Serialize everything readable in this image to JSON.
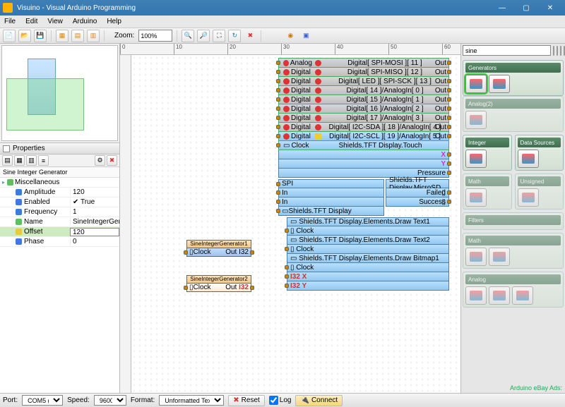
{
  "title": "Visuino - Visual Arduino Programming",
  "menu": [
    "File",
    "Edit",
    "View",
    "Arduino",
    "Help"
  ],
  "toolbar": {
    "zoom_label": "Zoom:",
    "zoom_value": "100%"
  },
  "ruler_ticks": [
    "0",
    "10",
    "20",
    "30",
    "40",
    "50",
    "60"
  ],
  "overview_title": "",
  "properties": {
    "panel_title": "Properties",
    "object_title": "Sine Integer Generator",
    "group": "Miscellaneous",
    "rows": [
      {
        "name": "Amplitude",
        "value": "120",
        "icon": "b"
      },
      {
        "name": "Enabled",
        "value": "✔ True",
        "icon": "b"
      },
      {
        "name": "Frequency",
        "value": "1",
        "icon": "b"
      },
      {
        "name": "Name",
        "value": "SineIntegerGenerator2",
        "icon": "g"
      },
      {
        "name": "Offset",
        "value": "120",
        "icon": "y",
        "selected": true
      },
      {
        "name": "Phase",
        "value": "0",
        "icon": "b"
      }
    ]
  },
  "board": {
    "top_labels": {
      "analog": "Analog",
      "digital": "Digital",
      "out": "Out"
    },
    "digital_rows": [
      "Digital[ SPI-MOSI ][ 11 ]",
      "Digital[ SPI-MISO ][ 12 ]",
      "Digital[ LED ][ SPI-SCK ][ 13 ]",
      "Digital[ 14 ]/AnalogIn[ 0 ]",
      "Digital[ 15 ]/AnalogIn[ 1 ]",
      "Digital[ 16 ]/AnalogIn[ 2 ]",
      "Digital[ 17 ]/AnalogIn[ 3 ]",
      "Digital[ I2C-SDA ][ 18 ]/AnalogIn[ 4 ]",
      "Digital[ I2C-SCL ][ 19 ]/AnalogIn[ 5 ]"
    ],
    "shield_row": {
      "left": "Clock",
      "label": "Shields.TFT Display.Touch",
      "outs": [
        "X",
        "Y",
        "Pressure"
      ]
    },
    "spi_block": {
      "rows": [
        "SPI",
        "In",
        "In"
      ],
      "tft_label": "Shields.TFT Display"
    },
    "microsd": {
      "label": "Shields.TFT Display.MicroSD",
      "outs": [
        "Failed",
        "Success"
      ]
    },
    "elements": [
      "Shields.TFT Display.Elements.Draw Text1",
      "Shields.TFT Display.Elements.Draw Text2",
      "Shields.TFT Display.Elements.Draw Bitmap1"
    ],
    "elem_ports": [
      "Clock",
      "Clock",
      "Clock",
      "I32 X",
      "I32 Y"
    ]
  },
  "generators": [
    {
      "name": "SineIntegerGenerator1",
      "in": "Clock",
      "out": "Out",
      "outtype": "I32"
    },
    {
      "name": "SineIntegerGenerator2",
      "in": "Clock",
      "out": "Out",
      "outtype": "I32"
    }
  ],
  "palette": {
    "search_value": "sine",
    "groups": [
      {
        "title": "Generators",
        "items": 2,
        "dim": false,
        "selected": 0
      },
      {
        "title": "Analog(2)",
        "items": 1,
        "dim": true
      }
    ],
    "row_groups": [
      [
        {
          "title": "Integer",
          "items": 1,
          "dim": false
        },
        {
          "title": "Data Sources",
          "items": 1,
          "dim": false
        }
      ],
      [
        {
          "title": "Math",
          "items": 1,
          "dim": true
        },
        {
          "title": "Unsigned",
          "items": 1,
          "dim": true
        }
      ],
      [
        {
          "title": "Filters",
          "items": 0,
          "dim": true
        }
      ],
      [
        {
          "title": "Math",
          "items": 2,
          "dim": true
        }
      ],
      [
        {
          "title": "Analog",
          "items": 3,
          "dim": true
        }
      ]
    ]
  },
  "statusbar": {
    "port_label": "Port:",
    "port_value": "COM5 (…",
    "speed_label": "Speed:",
    "speed_value": "9600",
    "format_label": "Format:",
    "format_value": "Unformatted Text",
    "reset": "Reset",
    "log": "Log",
    "connect": "Connect"
  },
  "ads_label": "Arduino eBay Ads:"
}
